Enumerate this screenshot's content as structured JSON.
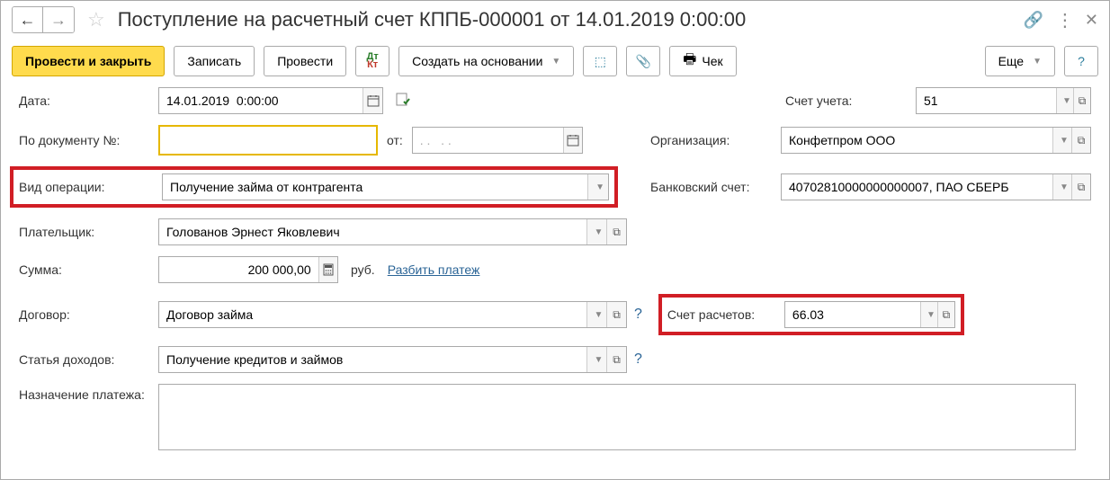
{
  "title": "Поступление на расчетный счет КППБ-000001 от 14.01.2019 0:00:00",
  "toolbar": {
    "post_close": "Провести и закрыть",
    "save": "Записать",
    "post": "Провести",
    "create_based": "Создать на основании",
    "cheque": "Чек",
    "more": "Еще"
  },
  "labels": {
    "date": "Дата:",
    "by_doc": "По документу №:",
    "from": "от:",
    "account": "Счет учета:",
    "org": "Организация:",
    "op_type": "Вид операции:",
    "bank_acc": "Банковский счет:",
    "payer": "Плательщик:",
    "sum": "Сумма:",
    "currency": "руб.",
    "split": "Разбить платеж",
    "contract": "Договор:",
    "settle_acc": "Счет расчетов:",
    "income_item": "Статья доходов:",
    "purpose": "Назначение платежа:"
  },
  "values": {
    "date": "14.01.2019  0:00:00",
    "by_doc": "",
    "from": ". .   . .",
    "account": "51",
    "org": "Конфетпром ООО",
    "op_type": "Получение займа от контрагента",
    "bank_acc": "40702810000000000007, ПАО СБЕРБ",
    "payer": "Голованов Эрнест Яковлевич",
    "sum": "200 000,00",
    "contract": "Договор займа",
    "settle_acc": "66.03",
    "income_item": "Получение кредитов и займов",
    "purpose": ""
  }
}
